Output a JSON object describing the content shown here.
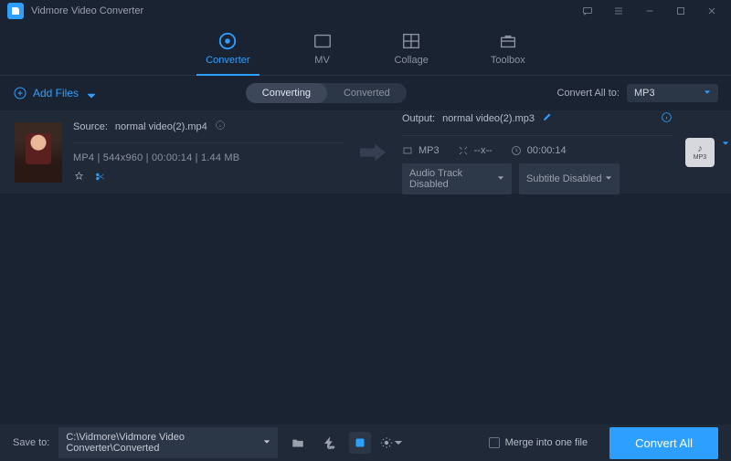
{
  "app": {
    "title": "Vidmore Video Converter"
  },
  "main_tabs": {
    "converter": "Converter",
    "mv": "MV",
    "collage": "Collage",
    "toolbox": "Toolbox"
  },
  "toolbar": {
    "add_files": "Add Files",
    "seg_converting": "Converting",
    "seg_converted": "Converted",
    "convert_all_to": "Convert All to:",
    "format": "MP3"
  },
  "file": {
    "source_label": "Source:",
    "source_name": "normal video(2).mp4",
    "meta": "MP4 | 544x960 | 00:00:14 | 1.44 MB",
    "output_label": "Output:",
    "output_name": "normal video(2).mp3",
    "out_fmt": "MP3",
    "out_res": "--x--",
    "out_dur": "00:00:14",
    "audio_track": "Audio Track Disabled",
    "subtitle": "Subtitle Disabled",
    "badge_fmt": "MP3"
  },
  "bottom": {
    "save_to_label": "Save to:",
    "save_path": "C:\\Vidmore\\Vidmore Video Converter\\Converted",
    "merge_label": "Merge into one file",
    "convert_all": "Convert All"
  }
}
